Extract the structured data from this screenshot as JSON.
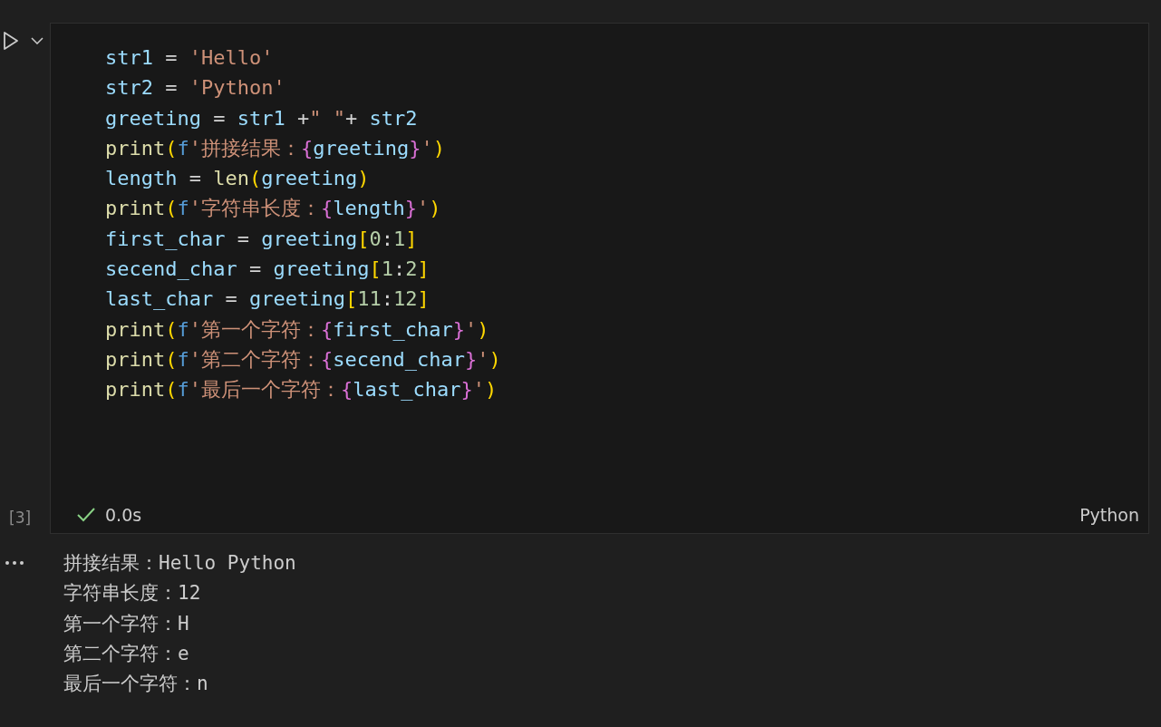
{
  "cell": {
    "execution_count": "[3]",
    "code_lines": [
      {
        "tokens": [
          {
            "kind": "var",
            "text": "str1"
          },
          {
            "kind": "op",
            "text": " = "
          },
          {
            "kind": "str",
            "text": "'Hello'"
          }
        ]
      },
      {
        "tokens": [
          {
            "kind": "var",
            "text": "str2"
          },
          {
            "kind": "op",
            "text": " = "
          },
          {
            "kind": "str",
            "text": "'Python'"
          }
        ]
      },
      {
        "tokens": [
          {
            "kind": "var",
            "text": "greeting"
          },
          {
            "kind": "op",
            "text": " = "
          },
          {
            "kind": "var",
            "text": "str1"
          },
          {
            "kind": "op",
            "text": " +"
          },
          {
            "kind": "str",
            "text": "\" \""
          },
          {
            "kind": "op",
            "text": "+ "
          },
          {
            "kind": "var",
            "text": "str2"
          }
        ]
      },
      {
        "tokens": [
          {
            "kind": "func",
            "text": "print"
          },
          {
            "kind": "bracket",
            "text": "("
          },
          {
            "kind": "prefix",
            "text": "f"
          },
          {
            "kind": "str",
            "text": "'拼接结果："
          },
          {
            "kind": "brace",
            "text": "{"
          },
          {
            "kind": "var",
            "text": "greeting"
          },
          {
            "kind": "brace",
            "text": "}"
          },
          {
            "kind": "str",
            "text": "'"
          },
          {
            "kind": "bracket",
            "text": ")"
          }
        ]
      },
      {
        "tokens": [
          {
            "kind": "var",
            "text": "length"
          },
          {
            "kind": "op",
            "text": " = "
          },
          {
            "kind": "func",
            "text": "len"
          },
          {
            "kind": "bracket",
            "text": "("
          },
          {
            "kind": "var",
            "text": "greeting"
          },
          {
            "kind": "bracket",
            "text": ")"
          }
        ]
      },
      {
        "tokens": [
          {
            "kind": "func",
            "text": "print"
          },
          {
            "kind": "bracket",
            "text": "("
          },
          {
            "kind": "prefix",
            "text": "f"
          },
          {
            "kind": "str",
            "text": "'字符串长度："
          },
          {
            "kind": "brace",
            "text": "{"
          },
          {
            "kind": "var",
            "text": "length"
          },
          {
            "kind": "brace",
            "text": "}"
          },
          {
            "kind": "str",
            "text": "'"
          },
          {
            "kind": "bracket",
            "text": ")"
          }
        ]
      },
      {
        "tokens": [
          {
            "kind": "var",
            "text": "first_char"
          },
          {
            "kind": "op",
            "text": " = "
          },
          {
            "kind": "var",
            "text": "greeting"
          },
          {
            "kind": "bracket",
            "text": "["
          },
          {
            "kind": "num",
            "text": "0"
          },
          {
            "kind": "op",
            "text": ":"
          },
          {
            "kind": "num",
            "text": "1"
          },
          {
            "kind": "bracket",
            "text": "]"
          }
        ]
      },
      {
        "tokens": [
          {
            "kind": "var",
            "text": "secend_char"
          },
          {
            "kind": "op",
            "text": " = "
          },
          {
            "kind": "var",
            "text": "greeting"
          },
          {
            "kind": "bracket",
            "text": "["
          },
          {
            "kind": "num",
            "text": "1"
          },
          {
            "kind": "op",
            "text": ":"
          },
          {
            "kind": "num",
            "text": "2"
          },
          {
            "kind": "bracket",
            "text": "]"
          }
        ]
      },
      {
        "tokens": [
          {
            "kind": "var",
            "text": "last_char"
          },
          {
            "kind": "op",
            "text": " = "
          },
          {
            "kind": "var",
            "text": "greeting"
          },
          {
            "kind": "bracket",
            "text": "["
          },
          {
            "kind": "num",
            "text": "11"
          },
          {
            "kind": "op",
            "text": ":"
          },
          {
            "kind": "num",
            "text": "12"
          },
          {
            "kind": "bracket",
            "text": "]"
          }
        ]
      },
      {
        "tokens": [
          {
            "kind": "func",
            "text": "print"
          },
          {
            "kind": "bracket",
            "text": "("
          },
          {
            "kind": "prefix",
            "text": "f"
          },
          {
            "kind": "str",
            "text": "'第一个字符："
          },
          {
            "kind": "brace",
            "text": "{"
          },
          {
            "kind": "var",
            "text": "first_char"
          },
          {
            "kind": "brace",
            "text": "}"
          },
          {
            "kind": "str",
            "text": "'"
          },
          {
            "kind": "bracket",
            "text": ")"
          }
        ]
      },
      {
        "tokens": [
          {
            "kind": "func",
            "text": "print"
          },
          {
            "kind": "bracket",
            "text": "("
          },
          {
            "kind": "prefix",
            "text": "f"
          },
          {
            "kind": "str",
            "text": "'第二个字符："
          },
          {
            "kind": "brace",
            "text": "{"
          },
          {
            "kind": "var",
            "text": "secend_char"
          },
          {
            "kind": "brace",
            "text": "}"
          },
          {
            "kind": "str",
            "text": "'"
          },
          {
            "kind": "bracket",
            "text": ")"
          }
        ]
      },
      {
        "tokens": [
          {
            "kind": "func",
            "text": "print"
          },
          {
            "kind": "bracket",
            "text": "("
          },
          {
            "kind": "prefix",
            "text": "f"
          },
          {
            "kind": "str",
            "text": "'最后一个字符："
          },
          {
            "kind": "brace",
            "text": "{"
          },
          {
            "kind": "var",
            "text": "last_char"
          },
          {
            "kind": "brace",
            "text": "}"
          },
          {
            "kind": "str",
            "text": "'"
          },
          {
            "kind": "bracket",
            "text": ")"
          }
        ]
      }
    ],
    "succeeded": true,
    "duration": "0.0s",
    "language": "Python"
  },
  "output": {
    "lines": [
      "拼接结果：Hello Python",
      "字符串长度：12",
      "第一个字符：H",
      "第二个字符：e",
      "最后一个字符：n"
    ]
  }
}
